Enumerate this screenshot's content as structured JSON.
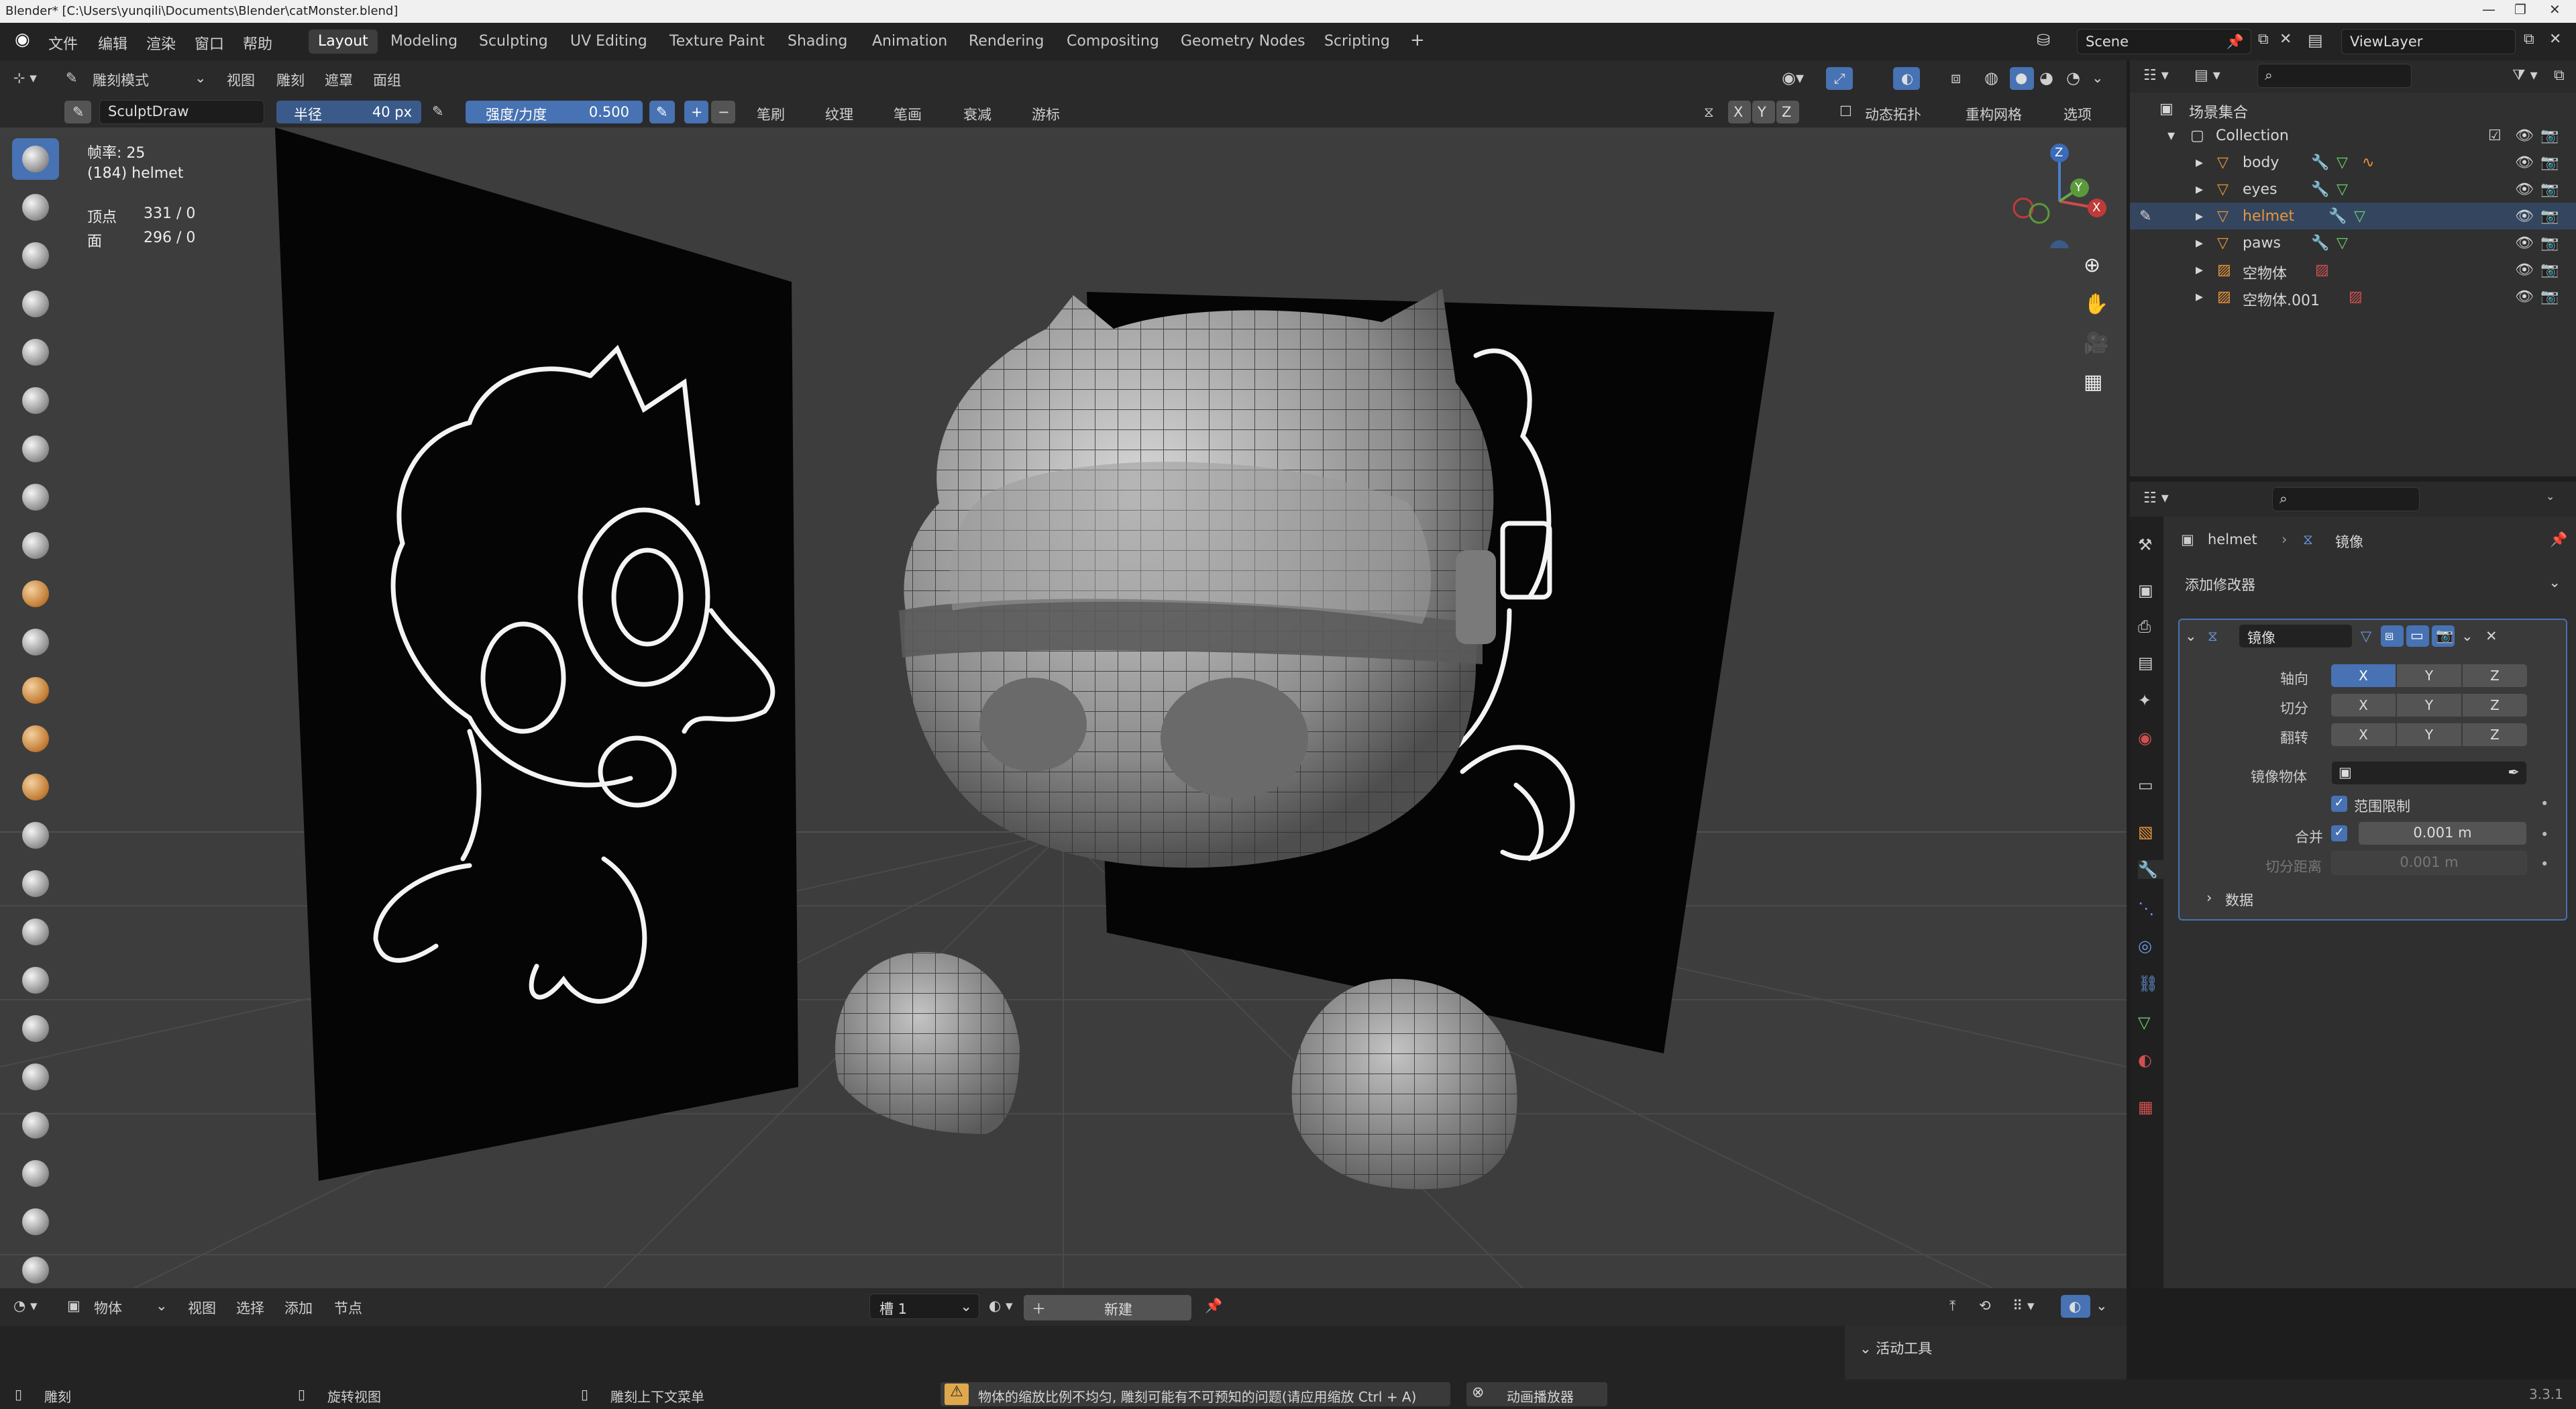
{
  "window": {
    "title": "Blender* [C:\\Users\\yunqili\\Documents\\Blender\\catMonster.blend]"
  },
  "menu": {
    "items": [
      "文件",
      "编辑",
      "渲染",
      "窗口",
      "帮助"
    ],
    "workspaces": [
      "Layout",
      "Modeling",
      "Sculpting",
      "UV Editing",
      "Texture Paint",
      "Shading",
      "Animation",
      "Rendering",
      "Compositing",
      "Geometry Nodes",
      "Scripting"
    ],
    "active_workspace": "Layout",
    "add_tab": "+",
    "scene": "Scene",
    "view_layer": "ViewLayer"
  },
  "viewport_header": {
    "mode": "雕刻模式",
    "menus": [
      "视图",
      "雕刻",
      "遮罩",
      "面组"
    ]
  },
  "tool_header": {
    "brush_name": "SculptDraw",
    "radius_label": "半径",
    "radius_value": "40 px",
    "strength_label": "强度/力度",
    "strength_value": "0.500",
    "plus": "+",
    "minus": "−",
    "menus": [
      "笔刷",
      "纹理",
      "笔画",
      "衰减",
      "游标"
    ],
    "axes": [
      "X",
      "Y",
      "Z"
    ],
    "dyntopo": "动态拓扑",
    "remesh": "重构网格",
    "options": "选项"
  },
  "overlay_info": {
    "frame": "帧率: 25",
    "object": "(184) helmet",
    "verts_label": "顶点",
    "verts_value": "331 / 0",
    "faces_label": "面",
    "faces_value": "296 / 0"
  },
  "gizmo": {
    "z": "Z",
    "y": "Y",
    "x": "X"
  },
  "bottom_header": {
    "mode": "物体",
    "menus": [
      "视图",
      "选择",
      "添加",
      "节点"
    ],
    "slot": "槽 1",
    "new_button": "新建"
  },
  "statusbar": {
    "sculpt": "雕刻",
    "rotate": "旋转视图",
    "context_menu": "雕刻上下文菜单",
    "warning": "物体的缩放比例不均匀, 雕刻可能有不可预知的问题(请应用缩放 Ctrl + A)",
    "player": "动画播放器",
    "version": "3.3.1"
  },
  "outliner": {
    "scene_collection": "场景集合",
    "collection": "Collection",
    "items": [
      {
        "name": "body"
      },
      {
        "name": "eyes"
      },
      {
        "name": "helmet",
        "selected": true
      },
      {
        "name": "paws"
      },
      {
        "name": "空物体"
      },
      {
        "name": "空物体.001"
      }
    ]
  },
  "properties": {
    "object": "helmet",
    "modifier_name_crumb": "镜像",
    "add_modifier": "添加修改器",
    "modifier": {
      "name": "镜像",
      "axis_label": "轴向",
      "bisect_label": "切分",
      "flip_label": "翻转",
      "xyz": [
        "X",
        "Y",
        "Z"
      ],
      "mirror_object_label": "镜像物体",
      "clipping_label": "范围限制",
      "merge_label": "合并",
      "merge_value": "0.001 m",
      "bisect_distance_label": "切分距离",
      "bisect_distance_value": "0.001 m",
      "data_label": "数据"
    },
    "active_tool": "活动工具"
  },
  "colors": {
    "accent": "#4772b3",
    "selected_object": "#e8953a",
    "warning": "#e0a84c"
  }
}
